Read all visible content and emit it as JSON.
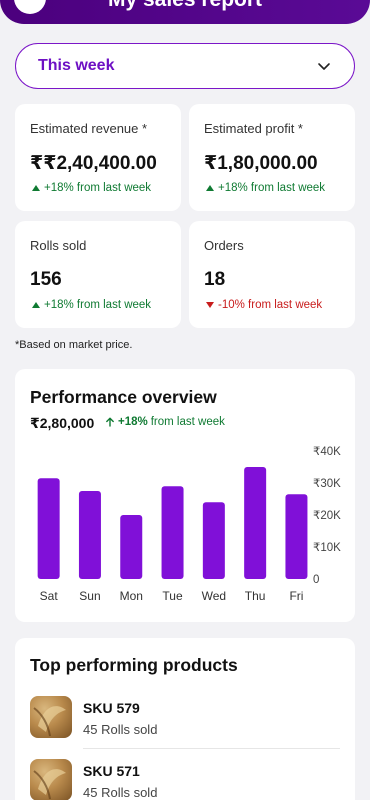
{
  "header": {
    "title": "My sales report"
  },
  "period_selector": {
    "selected": "This week"
  },
  "stats": [
    {
      "id": "estimated-revenue",
      "label": "Estimated revenue *",
      "value": "₹₹2,40,400.00",
      "delta": "+18% from last week",
      "trend": "up"
    },
    {
      "id": "estimated-profit",
      "label": "Estimated profit *",
      "value": "₹1,80,000.00",
      "delta": "+18% from last week",
      "trend": "up"
    },
    {
      "id": "rolls-sold",
      "label": "Rolls sold",
      "value": "156",
      "delta": "+18% from last week",
      "trend": "up"
    },
    {
      "id": "orders",
      "label": "Orders",
      "value": "18",
      "delta": "-10% from last week",
      "trend": "down"
    }
  ],
  "footnote": "*Based on market price.",
  "performance": {
    "title": "Performance overview",
    "total": "₹2,80,000",
    "delta_value": "+18%",
    "delta_text": "from last week"
  },
  "chart_data": {
    "type": "bar",
    "categories": [
      "Sat",
      "Sun",
      "Mon",
      "Tue",
      "Wed",
      "Thu",
      "Fri"
    ],
    "values": [
      31500,
      27500,
      20000,
      29000,
      24000,
      35000,
      26500
    ],
    "ylim": [
      0,
      40000
    ],
    "yticks": [
      0,
      10000,
      20000,
      30000,
      40000
    ],
    "ytick_labels": [
      "0",
      "₹10K",
      "₹20K",
      "₹30K",
      "₹40K"
    ],
    "bar_color": "#8010d8",
    "grid": false
  },
  "top_products": {
    "title": "Top performing products",
    "items": [
      {
        "sku": "SKU 579",
        "sold": "45 Rolls sold"
      },
      {
        "sku": "SKU 571",
        "sold": "45 Rolls sold"
      }
    ]
  },
  "colors": {
    "brand": "#6e10c4",
    "up": "#0f7a32",
    "down": "#c81c1c"
  }
}
